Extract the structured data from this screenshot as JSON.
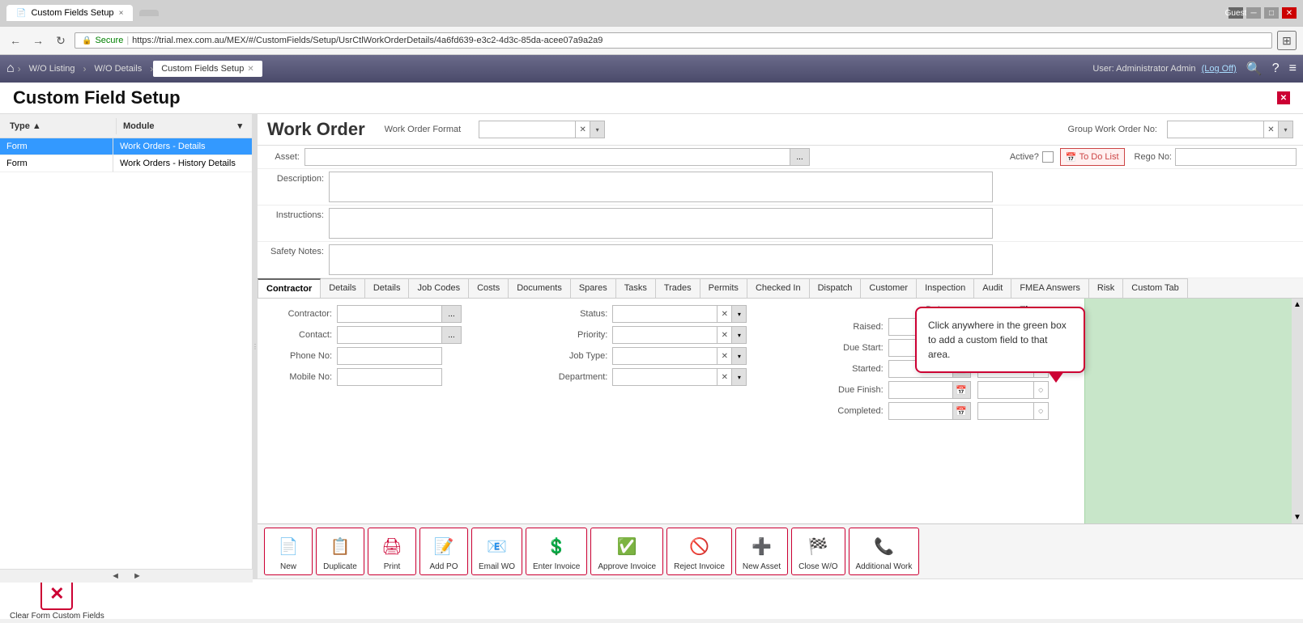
{
  "browser": {
    "tab_label": "Custom Fields Setup",
    "tab_close": "×",
    "tab_inactive": "",
    "url": "https://trial.mex.com.au/MEX/#/CustomFields/Setup/UsrCtlWorkOrderDetails/4a6fd639-e3c2-4d3c-85da-acee07a9a2a9",
    "secure_label": "Secure",
    "guest_label": "Guest",
    "back_icon": "←",
    "forward_icon": "→",
    "refresh_icon": "↻",
    "home_icon": "⌂",
    "win_minimize": "─",
    "win_restore": "□",
    "win_close": "✕"
  },
  "breadcrumb": {
    "home_icon": "⌂",
    "items": [
      {
        "label": "W/O Listing",
        "active": false
      },
      {
        "label": "W/O Details",
        "active": false
      },
      {
        "label": "Custom Fields Setup",
        "active": true
      }
    ],
    "tab_close": "×",
    "user_text": "User: Administrator Admin",
    "log_off": "(Log Off)",
    "search_icon": "🔍",
    "help_icon": "?",
    "menu_icon": "≡"
  },
  "page_title": "Custom Field Setup",
  "sidebar": {
    "col_type": "Type ▲",
    "col_module": "Module",
    "rows": [
      {
        "type": "Form",
        "module": "Work Orders - Details",
        "selected": true
      },
      {
        "type": "Form",
        "module": "Work Orders - History Details",
        "selected": false
      }
    ]
  },
  "workorder": {
    "title": "Work Order",
    "format_label": "Work Order Format",
    "group_wo_label": "Group Work Order No:",
    "asset_label": "Asset:",
    "active_label": "Active?",
    "todo_label": "To Do List",
    "rego_label": "Rego No:",
    "description_label": "Description:",
    "instructions_label": "Instructions:",
    "safety_notes_label": "Safety Notes:"
  },
  "tabs": [
    "Contractor",
    "Details",
    "Details",
    "Job Codes",
    "Costs",
    "Documents",
    "Spares",
    "Tasks",
    "Trades",
    "Permits",
    "Checked In",
    "Dispatch",
    "Customer",
    "Inspection",
    "Audit",
    "FMEA Answers",
    "Risk",
    "Custom Tab"
  ],
  "active_tab": "Contractor",
  "contractor_form": {
    "contractor_label": "Contractor:",
    "contact_label": "Contact:",
    "phone_label": "Phone No:",
    "mobile_label": "Mobile No:",
    "status_label": "Status:",
    "priority_label": "Priority:",
    "job_type_label": "Job Type:",
    "department_label": "Department:"
  },
  "date_time": {
    "date_col": "Date",
    "time_col": "Time",
    "rows": [
      {
        "label": "Raised:"
      },
      {
        "label": "Due Start:"
      },
      {
        "label": "Started:"
      },
      {
        "label": "Due Finish:"
      },
      {
        "label": "Completed:"
      }
    ]
  },
  "callout": {
    "text": "Click anywhere in the green box to add a custom field to that area."
  },
  "toolbar": {
    "buttons": [
      {
        "id": "new",
        "label": "New",
        "icon": "📄"
      },
      {
        "id": "duplicate",
        "label": "Duplicate",
        "icon": "📋"
      },
      {
        "id": "print",
        "label": "Print",
        "icon": "🖨"
      },
      {
        "id": "add-po",
        "label": "Add PO",
        "icon": "📝"
      },
      {
        "id": "email-wo",
        "label": "Email WO",
        "icon": "📧"
      },
      {
        "id": "enter-invoice",
        "label": "Enter Invoice",
        "icon": "💲"
      },
      {
        "id": "approve-invoice",
        "label": "Approve Invoice",
        "icon": "✅"
      },
      {
        "id": "reject-invoice",
        "label": "Reject Invoice",
        "icon": "🚫"
      },
      {
        "id": "new-asset",
        "label": "New Asset",
        "icon": "➕"
      },
      {
        "id": "close-wo",
        "label": "Close W/O",
        "icon": "🏁"
      },
      {
        "id": "additional-work",
        "label": "Additional Work",
        "icon": "📞"
      }
    ]
  },
  "bottom": {
    "clear_label": "Clear Form Custom Fields",
    "clear_icon": "✕"
  },
  "icons": {
    "browse": "...",
    "calendar": "📅",
    "clock": "🕐"
  }
}
